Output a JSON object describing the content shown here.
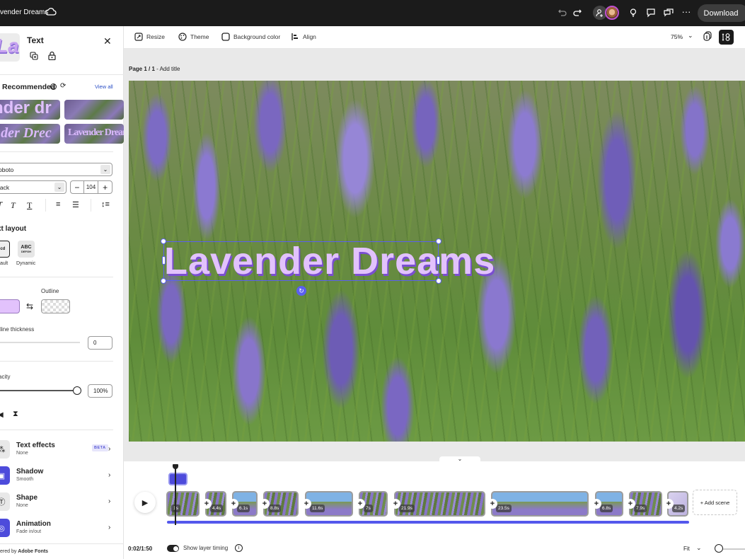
{
  "app": {
    "doc_title": "vender Dreams",
    "download_label": "Download"
  },
  "panel": {
    "title": "Text",
    "thumb_text": "La",
    "recommended_label": "Recommended",
    "view_all": "View all",
    "recommended_items": [
      "nder dr",
      "",
      "nder Drec",
      "Lavender Dream"
    ],
    "font_family": "Roboto",
    "font_family_visible": "oboto",
    "font_weight": "Black",
    "font_weight_visible": "lack",
    "font_size": "104",
    "text_layout_label": "xt layout",
    "layout_options": [
      {
        "label": "fault",
        "glyph": "bcd",
        "selected": true
      },
      {
        "label": "Dynamic",
        "glyph": "ABC",
        "selected": false
      }
    ],
    "outline_label": "Outline",
    "fill_color": "#e2c2fc",
    "outline_thickness_label": "tline thickness",
    "outline_thickness_value": "0",
    "opacity_label": "acity",
    "opacity_value": "100%",
    "opacity_fraction": 1.0,
    "properties": [
      {
        "name": "Text effects",
        "value": "None",
        "badge": "BETA"
      },
      {
        "name": "Shadow",
        "value": "Smooth"
      },
      {
        "name": "Shape",
        "value": "None"
      },
      {
        "name": "Animation",
        "value": "Fade in/out"
      }
    ],
    "footer_prefix": "ered by ",
    "footer_brand": "Adobe Fonts"
  },
  "toolbar": {
    "resize": "Resize",
    "theme": "Theme",
    "background_color": "Background color",
    "align": "Align",
    "zoom": "75%"
  },
  "stage": {
    "page_label": "Page 1 / 1",
    "add_title": " - Add title",
    "canvas_text": "Lavender Dreams"
  },
  "timeline": {
    "clips": [
      {
        "dur": "1s",
        "style": "lav"
      },
      {
        "dur": "4.4s",
        "style": "lav"
      },
      {
        "dur": "6.1s",
        "style": "sky"
      },
      {
        "dur": "8.8s",
        "style": "lav"
      },
      {
        "dur": "11.6s",
        "style": "sky"
      },
      {
        "dur": "7s",
        "style": "lav"
      },
      {
        "dur": "21.9s",
        "style": "lav"
      },
      {
        "dur": "23.5s",
        "style": "sky"
      },
      {
        "dur": "6.8s",
        "style": "sky"
      },
      {
        "dur": "7.9s",
        "style": "lav"
      },
      {
        "dur": "4.2s",
        "style": "pale"
      }
    ],
    "add_scene": "+ Add scene",
    "timecode": "0:02/1:50",
    "show_layer_timing": "Show layer timing",
    "show_layer_timing_on": true,
    "fit_label": "Fit"
  },
  "colors": {
    "accent": "#5458ec",
    "topbar": "#1b1b1b",
    "text_fill": "#e2c2fc"
  }
}
